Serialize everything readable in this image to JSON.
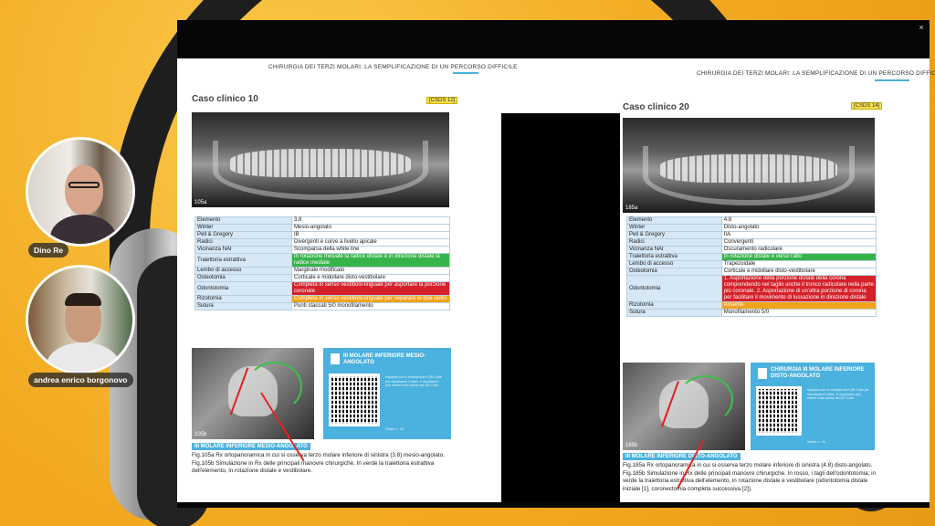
{
  "participants": [
    {
      "name": "Dino Re"
    },
    {
      "name": "andrea enrico borgonovo"
    }
  ],
  "viewer": {
    "close_glyph": "×"
  },
  "book": {
    "header_title": "CHIRURGIA DEI TERZI MOLARI: LA SEMPLIFICAZIONE DI UN PERCORSO DIFFICILE"
  },
  "left_page": {
    "case_title": "Caso clinico 10",
    "case_code": "[CSDS 12]",
    "xray_label": "105a",
    "table": [
      {
        "k": "Elemento",
        "v": "3.8",
        "style": "v"
      },
      {
        "k": "Winter",
        "v": "Mesio-angolato",
        "style": "v"
      },
      {
        "k": "Pell & Gregory",
        "v": "IB",
        "style": "v"
      },
      {
        "k": "Radici",
        "v": "Divergenti e curve a livello apicale",
        "style": "v"
      },
      {
        "k": "Vicinanza NAI",
        "v": "Scomparsa della white line",
        "style": "v"
      },
      {
        "k": "Traiettoria estrattiva",
        "v": "In rotazione mesiale la radice distale e in direzione distale la radice mediale",
        "style": "g"
      },
      {
        "k": "Lembo di accesso",
        "v": "Marginale modificato",
        "style": "v"
      },
      {
        "k": "Osteotomia",
        "v": "Corticale e midollare disto-vestibolare",
        "style": "v"
      },
      {
        "k": "Odontotomia",
        "v": "Completa in senso vestibolo-linguale per asportare la porzione coronale",
        "style": "r"
      },
      {
        "k": "Rizotomia",
        "v": "Completa in senso vestibolo-linguale per separare le due radici",
        "style": "o"
      },
      {
        "k": "Sutura",
        "v": "Punti staccati 5/0 monofilamento",
        "style": "v"
      }
    ],
    "small_xray_label": "105b",
    "qr_title": "III MOLARE INFERIORE MESIO-ANGOLATO",
    "qr_text": "Inquadra con lo smartphone il QR Code per visualizzare il video. Il documento può essere fruito anche dal QR Code.",
    "qr_video": "Video n. 10",
    "caption_bar": "III MOLARE INFERIORE MESIO-ANGOLATO",
    "caption": "Fig.105a Rx ortopanoramica in cui si osserva terzo molare inferiore di sinistra (3.8) mesio-angolato.   Fig.105b Simulazione in Rx delle principali manovre chirurgiche. In verde la traiettoria estrattiva dell'elemento, in rotazione distale e vestibolare."
  },
  "right_page": {
    "case_title": "Caso clinico 20",
    "case_code": "[CSDS 14]",
    "xray_label": "185a",
    "table": [
      {
        "k": "Elemento",
        "v": "4.8",
        "style": "v"
      },
      {
        "k": "Winter",
        "v": "Disto-angolato",
        "style": "v"
      },
      {
        "k": "Pell & Gregory",
        "v": "IIA",
        "style": "v"
      },
      {
        "k": "Radici",
        "v": "Convergenti",
        "style": "v"
      },
      {
        "k": "Vicinanza NAI",
        "v": "Oscuramento radicolare",
        "style": "v"
      },
      {
        "k": "Traiettoria estrattiva",
        "v": "In rotazione distale e verso l'alto",
        "style": "g"
      },
      {
        "k": "Lembo di accesso",
        "v": "Trapezoidale",
        "style": "v"
      },
      {
        "k": "Osteotomia",
        "v": "Corticale e midollare disto-vestibolare",
        "style": "v"
      },
      {
        "k": "Odontotomia",
        "v": "1. Asportazione della porzione distale della corona comprendendo nel taglio anche il tronco radicolare nella parte più coronale. 2. Asportazione di un'altra porzione di corona per facilitare il movimento di lussazione in direzione distale",
        "style": "r"
      },
      {
        "k": "Rizotomia",
        "v": "Assente",
        "style": "o"
      },
      {
        "k": "Sutura",
        "v": "Monofilamento 5/0",
        "style": "v"
      }
    ],
    "small_xray_label": "185b",
    "qr_title": "CHIRURGIA III MOLARE INFERIORE DISTO-ANGOLATO",
    "qr_text": "Inquadra con lo smartphone il QR Code per visualizzare il video. Il documento può essere fruito anche dal QR Code.",
    "qr_video": "Video n. 21",
    "caption_bar": "III MOLARE INFERIORE DISTO-ANGOLATO",
    "caption": "Fig.185a Rx ortopanoramica in cui si osserva terzo molare inferiore di sinistra (4.8) disto-angolato.   Fig.185b Simulazione in Rx delle principali manovre chirurgiche. In rosso, i tagli dell'odontotomia; in verde la traiettoria estrattiva dell'elemento, in rotazione distale e vestibolare (odontotomia distale iniziale [1], coronectomia completa successiva [2])."
  }
}
